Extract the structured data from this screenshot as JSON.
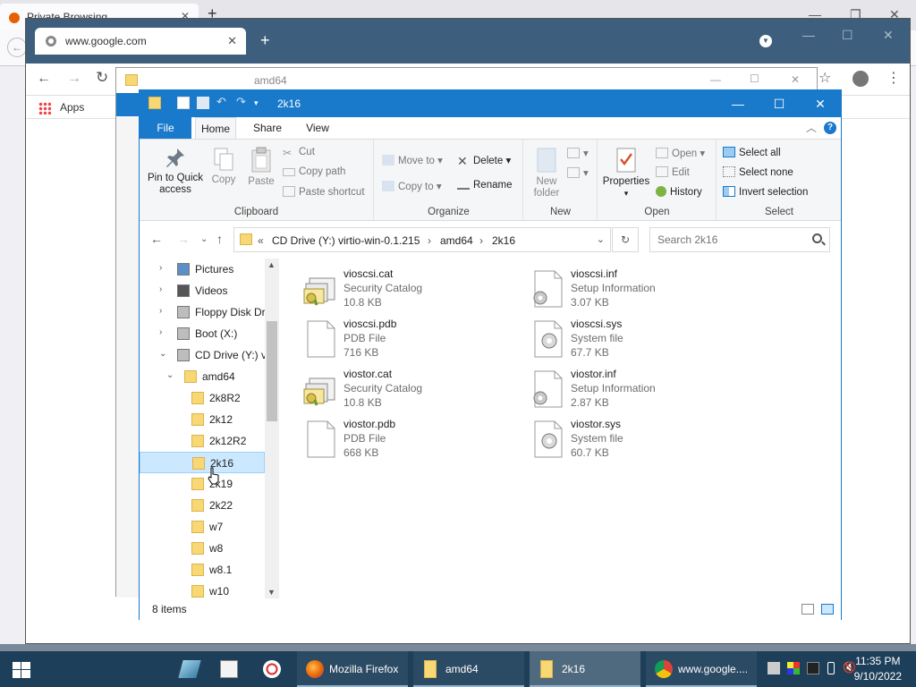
{
  "firefox": {
    "tab_title": "Private Browsing",
    "close_glyph": "✕",
    "plus_glyph": "+"
  },
  "chrome": {
    "tab_title": "www.google.com",
    "close_glyph": "✕",
    "plus_glyph": "+",
    "bookmarks_apps": "Apps"
  },
  "amd_window": {
    "title": "amd64"
  },
  "explorer": {
    "title": "2k16",
    "window_buttons": {
      "minimize": "—",
      "maximize": "☐",
      "close": "✕"
    },
    "ribbon_tabs": {
      "file": "File",
      "home": "Home",
      "share": "Share",
      "view": "View"
    },
    "ribbon": {
      "clipboard": {
        "label": "Clipboard",
        "pin": "Pin to Quick access",
        "copy": "Copy",
        "paste": "Paste",
        "cut": "Cut",
        "copy_path": "Copy path",
        "paste_shortcut": "Paste shortcut"
      },
      "organize": {
        "label": "Organize",
        "move_to": "Move to",
        "copy_to": "Copy to",
        "delete": "Delete",
        "rename": "Rename"
      },
      "new": {
        "label": "New",
        "new_folder": "New folder"
      },
      "open": {
        "label": "Open",
        "properties": "Properties",
        "open": "Open",
        "edit": "Edit",
        "history": "History"
      },
      "select": {
        "label": "Select",
        "select_all": "Select all",
        "select_none": "Select none",
        "invert_selection": "Invert selection"
      }
    },
    "address": {
      "prefix": "«",
      "crumbs": [
        "CD Drive (Y:) virtio-win-0.1.215",
        "amd64",
        "2k16"
      ],
      "separator": "›",
      "search_placeholder": "Search 2k16"
    },
    "nav_tree": [
      {
        "label": "Pictures",
        "expand": "›"
      },
      {
        "label": "Videos",
        "expand": "›"
      },
      {
        "label": "Floppy Disk Dri",
        "expand": "›"
      },
      {
        "label": "Boot (X:)",
        "expand": "›"
      },
      {
        "label": "CD Drive (Y:) vi",
        "expand": "⌄"
      },
      {
        "label": "amd64",
        "expand": "⌄"
      },
      {
        "label": "2k8R2"
      },
      {
        "label": "2k12"
      },
      {
        "label": "2k12R2"
      },
      {
        "label": "2k16"
      },
      {
        "label": "2k19"
      },
      {
        "label": "2k22"
      },
      {
        "label": "w7"
      },
      {
        "label": "w8"
      },
      {
        "label": "w8.1"
      },
      {
        "label": "w10"
      }
    ],
    "files": [
      {
        "name": "vioscsi.cat",
        "type": "Security Catalog",
        "size": "10.8 KB",
        "icon": "catalog-icon"
      },
      {
        "name": "vioscsi.inf",
        "type": "Setup Information",
        "size": "3.07 KB",
        "icon": "setup-info-icon"
      },
      {
        "name": "vioscsi.pdb",
        "type": "PDB File",
        "size": "716 KB",
        "icon": "blank-file-icon"
      },
      {
        "name": "vioscsi.sys",
        "type": "System file",
        "size": "67.7 KB",
        "icon": "system-file-icon"
      },
      {
        "name": "viostor.cat",
        "type": "Security Catalog",
        "size": "10.8 KB",
        "icon": "catalog-icon"
      },
      {
        "name": "viostor.inf",
        "type": "Setup Information",
        "size": "2.87 KB",
        "icon": "setup-info-icon"
      },
      {
        "name": "viostor.pdb",
        "type": "PDB File",
        "size": "668 KB",
        "icon": "blank-file-icon"
      },
      {
        "name": "viostor.sys",
        "type": "System file",
        "size": "60.7 KB",
        "icon": "system-file-icon"
      }
    ],
    "status": "8 items"
  },
  "taskbar": {
    "firefox": "Mozilla Firefox",
    "amd64": "amd64",
    "k16": "2k16",
    "chrome": "www.google....",
    "time": "11:35 PM",
    "date": "9/10/2022"
  },
  "colors": {
    "accent": "#1979ca",
    "taskbar": "#1e3f5a",
    "folder": "#f8d775"
  }
}
